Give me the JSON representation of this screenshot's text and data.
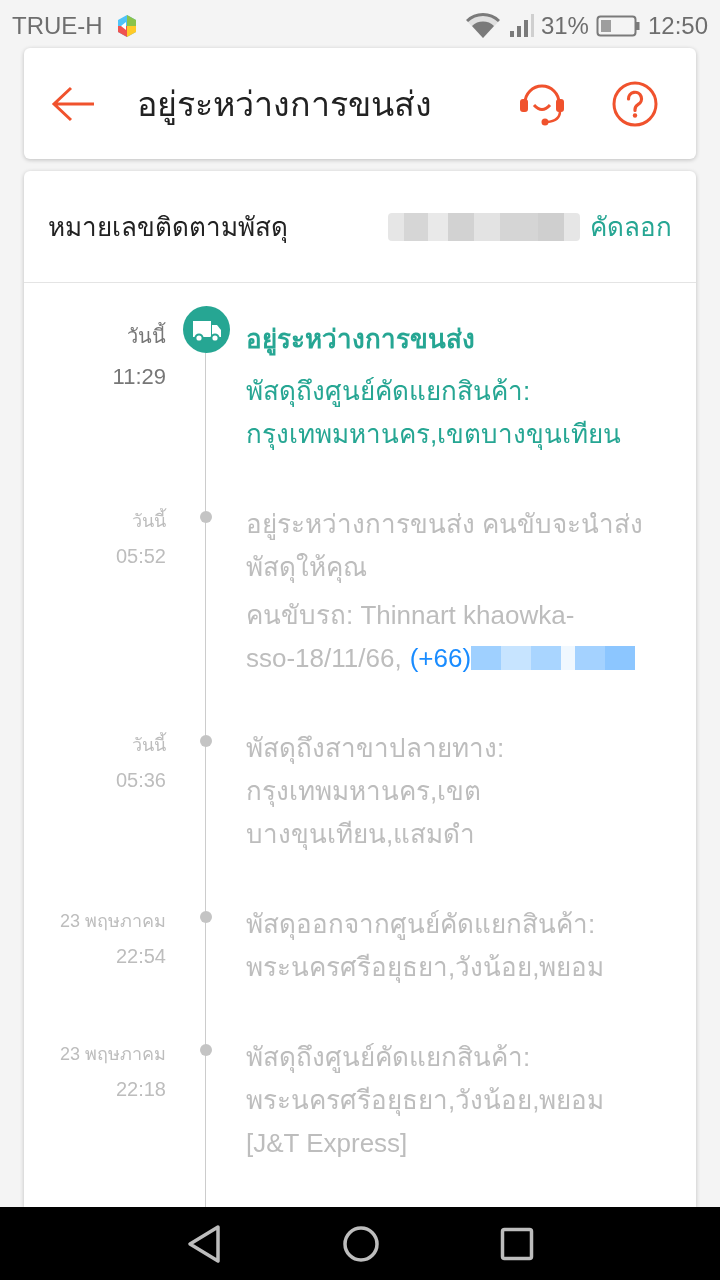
{
  "status_bar": {
    "carrier": "TRUE-H",
    "battery": "31%",
    "time": "12:50"
  },
  "header": {
    "title": "อยู่ระหว่างการขนส่ง"
  },
  "tracking": {
    "label": "หมายเลขติดตามพัสดุ",
    "copy_button": "คัดลอก"
  },
  "events": [
    {
      "date": "วันนี้",
      "time": "11:29",
      "current": true,
      "title": "อยู่ระหว่างการขนส่ง",
      "paragraphs": [
        {
          "text": "พัสดุถึงศูนย์คัดแยกสินค้า:\nกรุงเทพมหานคร,เขตบางขุนเทียน"
        }
      ]
    },
    {
      "date": "วันนี้",
      "time": "05:52",
      "current": false,
      "paragraphs": [
        {
          "text": "อยู่ระหว่างการขนส่ง คนขับจะนำส่ง\nพัสดุให้คุณ"
        },
        {
          "text": "คนขับรถ: Thinnart khaowka-\nsso-18/11/66,",
          "phone": "(+66)"
        }
      ]
    },
    {
      "date": "วันนี้",
      "time": "05:36",
      "current": false,
      "paragraphs": [
        {
          "text": "พัสดุถึงสาขาปลายทาง:\nกรุงเทพมหานคร,เขต\nบางขุนเทียน,แสมดำ"
        }
      ]
    },
    {
      "date": "23 พฤษภาคม",
      "time": "22:54",
      "current": false,
      "paragraphs": [
        {
          "text": "พัสดุออกจากศูนย์คัดแยกสินค้า:\nพระนครศรีอยุธยา,วังน้อย,พยอม"
        }
      ]
    },
    {
      "date": "23 พฤษภาคม",
      "time": "22:18",
      "current": false,
      "paragraphs": [
        {
          "text": "พัสดุถึงศูนย์คัดแยกสินค้า:\nพระนครศรีอยุธยา,วังน้อย,พยอม\n[J&T Express]"
        }
      ]
    }
  ]
}
